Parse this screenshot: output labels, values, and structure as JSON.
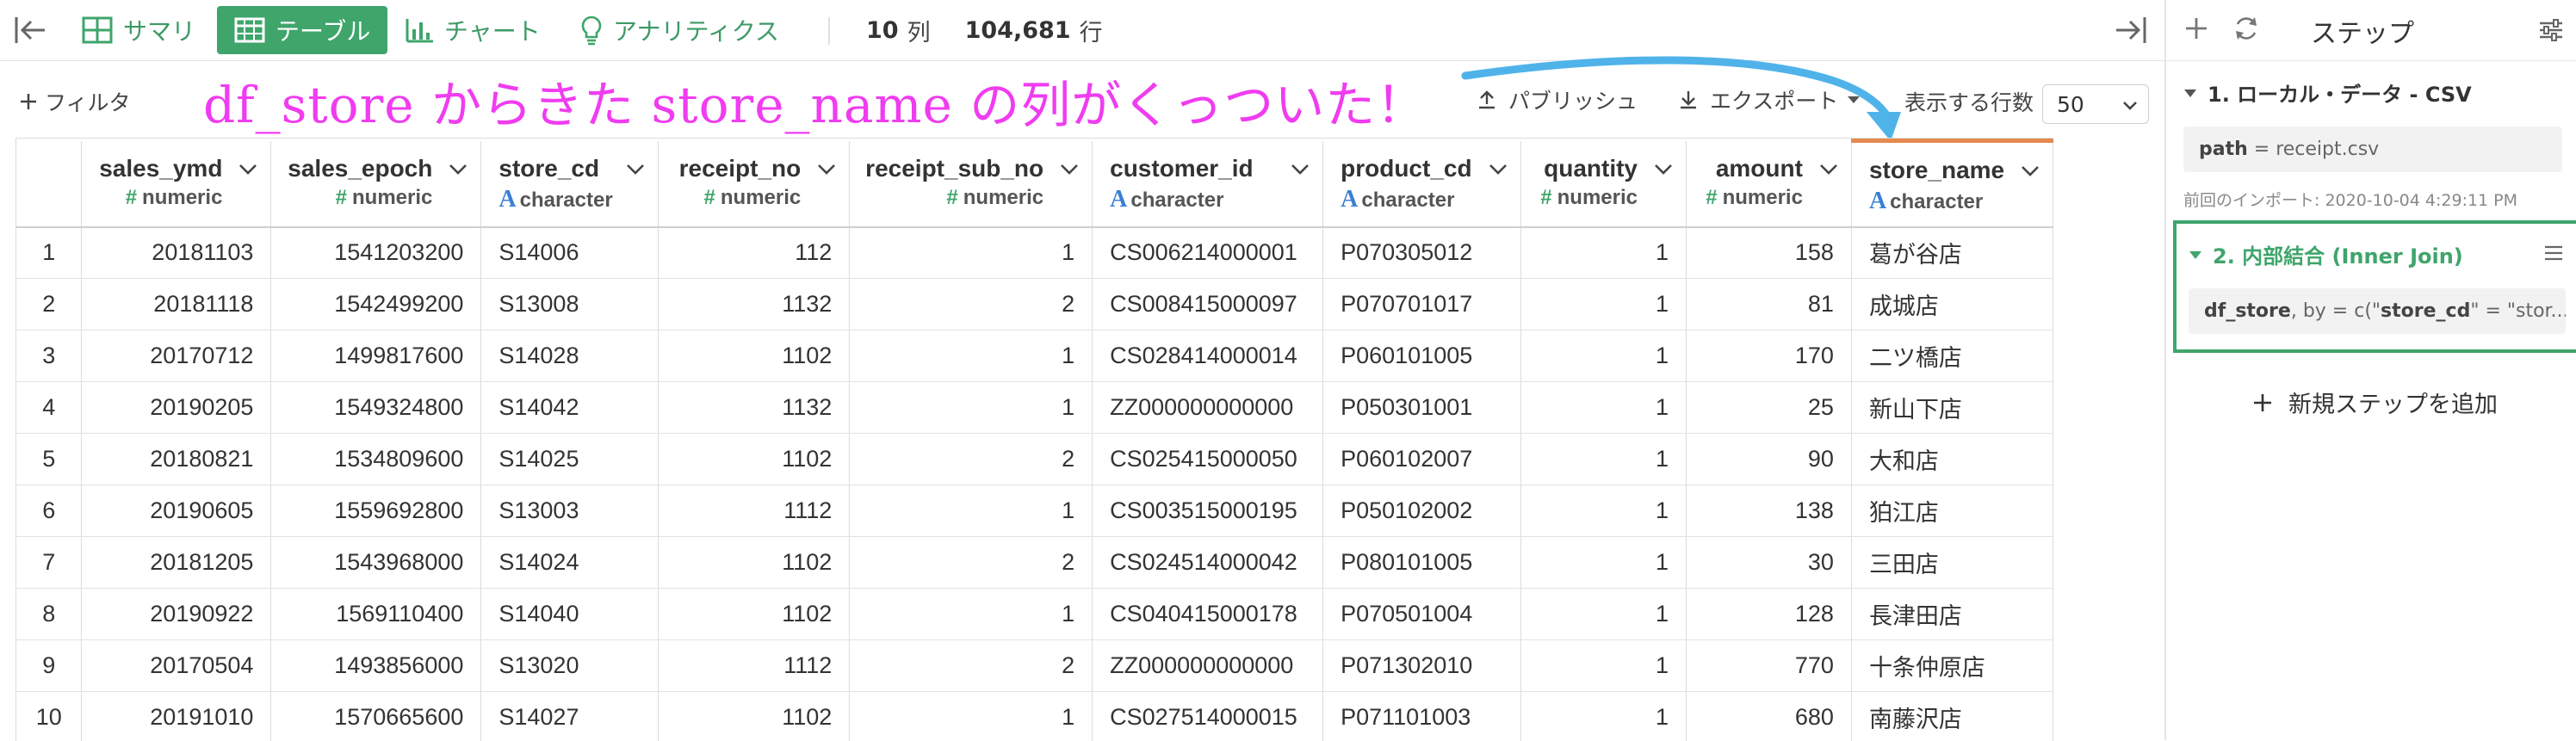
{
  "toolbar": {
    "tabs": [
      {
        "label": "サマリ",
        "icon": "summary-grid-icon"
      },
      {
        "label": "テーブル",
        "icon": "table-icon"
      },
      {
        "label": "チャート",
        "icon": "bar-chart-icon"
      },
      {
        "label": "アナリティクス",
        "icon": "lightbulb-icon"
      }
    ],
    "columns_count": "10",
    "columns_unit": "列",
    "rows_count": "104,681",
    "rows_unit": "行"
  },
  "subbar": {
    "filter_label": "フィルタ",
    "annotation": "df_store からきた store_name の列がくっついた！",
    "publish_label": "パブリッシュ",
    "export_label": "エクスポート",
    "rows_label": "表示する行数",
    "rows_value": "50"
  },
  "colors": {
    "accent_green": "#3fa56b",
    "annotation_pink": "#f03cf0",
    "arrow_blue": "#4fb3ea",
    "highlight_orange": "#e58a4e",
    "character_blue": "#3a7fd5"
  },
  "table": {
    "columns": [
      {
        "name": "sales_ymd",
        "type": "numeric"
      },
      {
        "name": "sales_epoch",
        "type": "numeric"
      },
      {
        "name": "store_cd",
        "type": "character"
      },
      {
        "name": "receipt_no",
        "type": "numeric"
      },
      {
        "name": "receipt_sub_no",
        "type": "numeric"
      },
      {
        "name": "customer_id",
        "type": "character"
      },
      {
        "name": "product_cd",
        "type": "character"
      },
      {
        "name": "quantity",
        "type": "numeric"
      },
      {
        "name": "amount",
        "type": "numeric"
      },
      {
        "name": "store_name",
        "type": "character"
      }
    ],
    "rows": [
      [
        "1",
        "20181103",
        "1541203200",
        "S14006",
        "112",
        "1",
        "CS006214000001",
        "P070305012",
        "1",
        "158",
        "葛が谷店"
      ],
      [
        "2",
        "20181118",
        "1542499200",
        "S13008",
        "1132",
        "2",
        "CS008415000097",
        "P070701017",
        "1",
        "81",
        "成城店"
      ],
      [
        "3",
        "20170712",
        "1499817600",
        "S14028",
        "1102",
        "1",
        "CS028414000014",
        "P060101005",
        "1",
        "170",
        "二ツ橋店"
      ],
      [
        "4",
        "20190205",
        "1549324800",
        "S14042",
        "1132",
        "1",
        "ZZ000000000000",
        "P050301001",
        "1",
        "25",
        "新山下店"
      ],
      [
        "5",
        "20180821",
        "1534809600",
        "S14025",
        "1102",
        "2",
        "CS025415000050",
        "P060102007",
        "1",
        "90",
        "大和店"
      ],
      [
        "6",
        "20190605",
        "1559692800",
        "S13003",
        "1112",
        "1",
        "CS003515000195",
        "P050102002",
        "1",
        "138",
        "狛江店"
      ],
      [
        "7",
        "20181205",
        "1543968000",
        "S14024",
        "1102",
        "2",
        "CS024514000042",
        "P080101005",
        "1",
        "30",
        "三田店"
      ],
      [
        "8",
        "20190922",
        "1569110400",
        "S14040",
        "1102",
        "1",
        "CS040415000178",
        "P070501004",
        "1",
        "128",
        "長津田店"
      ],
      [
        "9",
        "20170504",
        "1493856000",
        "S13020",
        "1112",
        "2",
        "ZZ000000000000",
        "P071302010",
        "1",
        "770",
        "十条仲原店"
      ],
      [
        "10",
        "20191010",
        "1570665600",
        "S14027",
        "1102",
        "1",
        "CS027514000015",
        "P071101003",
        "1",
        "680",
        "南藤沢店"
      ]
    ]
  },
  "panel": {
    "title": "ステップ",
    "step1": {
      "title": "1. ローカル・データ - CSV",
      "code_key": "path",
      "code_rest": " = receipt.csv",
      "meta": "前回のインポート: 2020-10-04 4:29:11 PM"
    },
    "step2": {
      "title": "2. 内部結合 (Inner Join)",
      "code_key": "df_store",
      "code_mid": ", by = c(\"",
      "code_key2": "store_cd",
      "code_tail": "\" = \"stor..."
    },
    "add_step_label": "新規ステップを追加"
  }
}
